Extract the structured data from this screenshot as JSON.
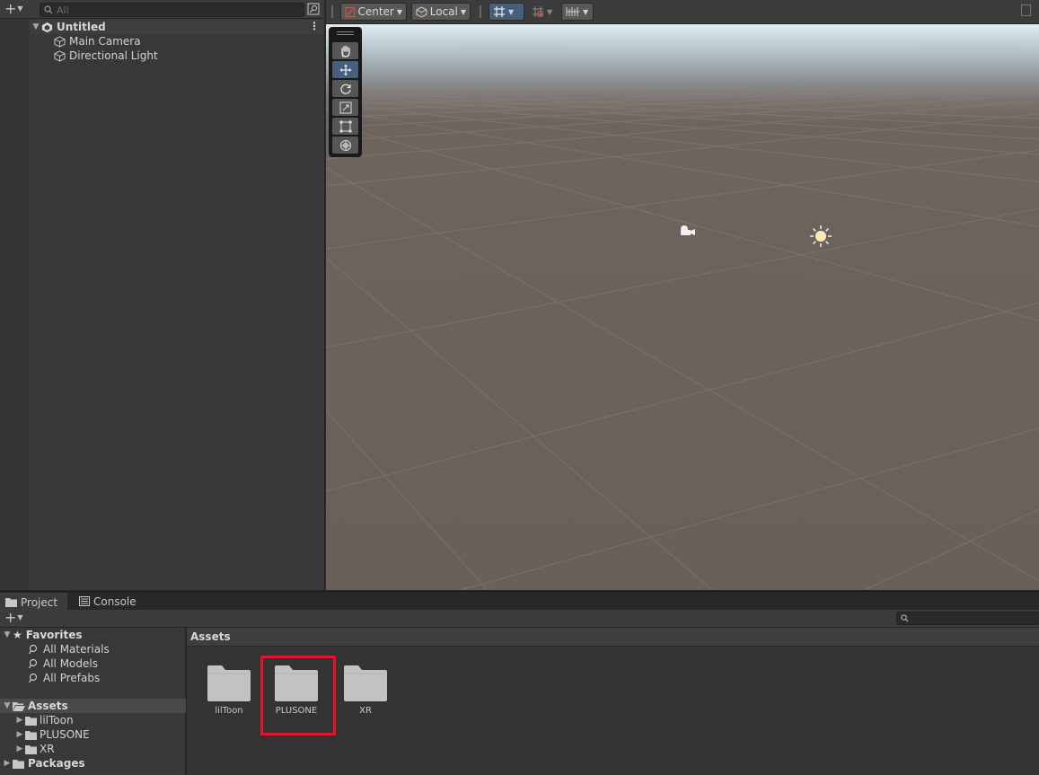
{
  "hierarchy": {
    "search_placeholder": "All",
    "scene_name": "Untitled",
    "items": [
      "Main Camera",
      "Directional Light"
    ]
  },
  "scene_toolbar": {
    "pivot_label": "Center",
    "space_label": "Local"
  },
  "bottom_tabs": {
    "project": "Project",
    "console": "Console"
  },
  "project": {
    "favorites_label": "Favorites",
    "favorites": [
      "All Materials",
      "All Models",
      "All Prefabs"
    ],
    "assets_label": "Assets",
    "asset_folders": [
      "lilToon",
      "PLUSONE",
      "XR"
    ],
    "packages_label": "Packages",
    "breadcrumb": "Assets",
    "grid_folders": [
      "lilToon",
      "PLUSONE",
      "XR"
    ]
  },
  "colors": {
    "selection_tool": "#46607c",
    "highlight": "#e0142a"
  }
}
